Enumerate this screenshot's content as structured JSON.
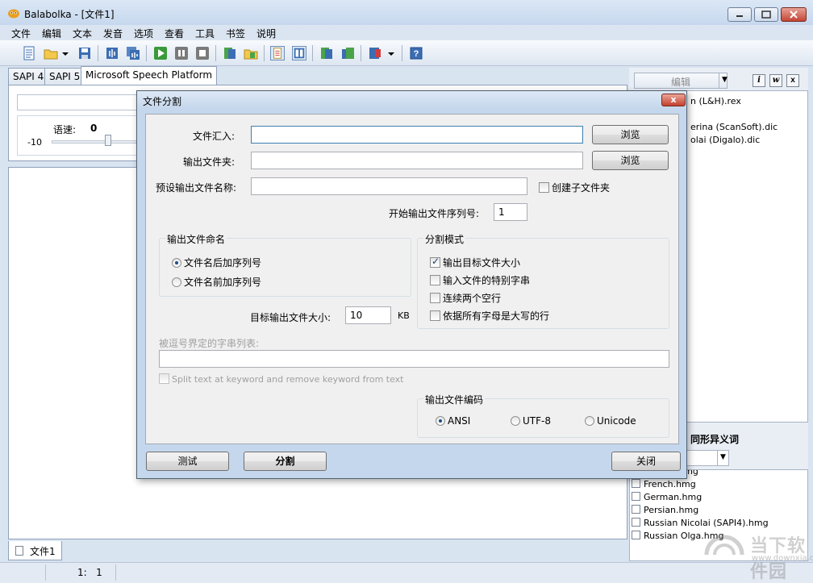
{
  "window": {
    "title": "Balabolka - [文件1]"
  },
  "menu": [
    "文件",
    "编辑",
    "文本",
    "发音",
    "选项",
    "查看",
    "工具",
    "书签",
    "说明"
  ],
  "engine_tabs": [
    "SAPI 4",
    "SAPI 5",
    "Microsoft Speech Platform"
  ],
  "rate": {
    "label": "语速:",
    "value": "0",
    "min": "-10"
  },
  "document_tab": "文件1",
  "status": {
    "position": "1:   1"
  },
  "right_panel": {
    "edit_combo": "编辑",
    "buttons": [
      "i",
      "w",
      "x"
    ],
    "dictionaries": [
      "n (L&H).rex",
      "erina (ScanSoft).dic",
      "olai (Digalo).dic"
    ],
    "homograph_title": "同形异义词",
    "homographs": [
      "English.hmg",
      "French.hmg",
      "German.hmg",
      "Persian.hmg",
      "Russian Nicolai (SAPI4).hmg",
      "Russian Olga.hmg"
    ]
  },
  "watermark": {
    "text": "当下软件园",
    "url": "www.downxia.com"
  },
  "dialog": {
    "title": "文件分割",
    "close": "x",
    "input_file_label": "文件汇入:",
    "input_file_value": "",
    "output_folder_label": "输出文件夹:",
    "output_folder_value": "",
    "browse_label": "浏览",
    "default_name_label": "预设输出文件名称:",
    "default_name_value": "",
    "create_subfolder_label": "创建子文件夹",
    "create_subfolder_checked": false,
    "start_seq_label": "开始输出文件序列号:",
    "start_seq_value": "1",
    "naming_group": {
      "title": "输出文件命名",
      "options": [
        "文件名后加序列号",
        "文件名前加序列号"
      ],
      "selected": 0
    },
    "split_group": {
      "title": "分割模式",
      "options": [
        {
          "label": "输出目标文件大小",
          "checked": true
        },
        {
          "label": "输入文件的特别字串",
          "checked": false
        },
        {
          "label": "连续两个空行",
          "checked": false
        },
        {
          "label": "依据所有字母是大写的行",
          "checked": false
        }
      ]
    },
    "target_size_label": "目标输出文件大小:",
    "target_size_value": "10",
    "target_size_unit": "KB",
    "delimited_label": "被逗号界定的字串列表:",
    "delimited_value": "",
    "keyword_split_label": "Split text at keyword and remove keyword from text",
    "encoding_group": {
      "title": "输出文件编码",
      "options": [
        "ANSI",
        "UTF-8",
        "Unicode"
      ],
      "selected": 0
    },
    "test_button": "测试",
    "split_button": "分割",
    "close_button": "关闭"
  },
  "colors": {
    "accent": "#3c7fb1",
    "close_red": "#c44534"
  }
}
